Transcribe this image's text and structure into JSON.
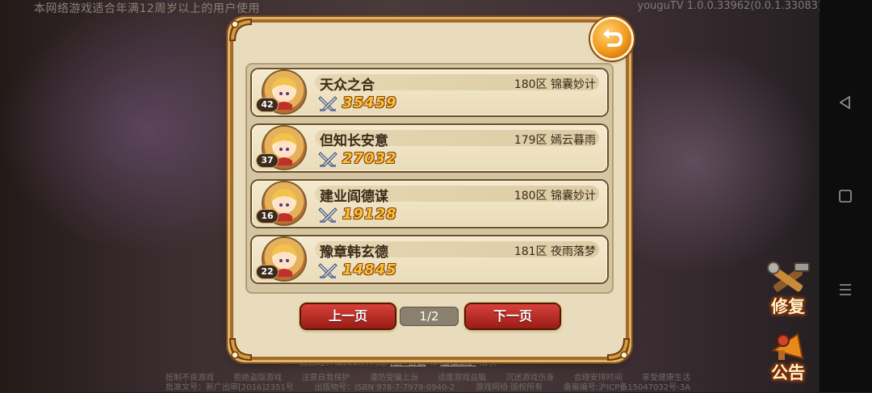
{
  "top_notice": "本网络游戏适合年满12周岁以上的用户使用",
  "version": "youguTV 1.0.0.33962(0.0.1.33083)",
  "leaderboard": {
    "rows": [
      {
        "level": "42",
        "name": "天众之合",
        "server": "180区 锦囊妙计",
        "power": "35459"
      },
      {
        "level": "37",
        "name": "但知长安意",
        "server": "179区 嫣云暮雨",
        "power": "27032"
      },
      {
        "level": "16",
        "name": "建业阎德谋",
        "server": "180区 锦囊妙计",
        "power": "19128"
      },
      {
        "level": "22",
        "name": "豫章韩玄德",
        "server": "181区 夜雨落梦",
        "power": "14845"
      }
    ],
    "prev_label": "上一页",
    "next_label": "下一页",
    "page_indicator": "1/2"
  },
  "footer": {
    "agree_prefix": "我已经详细阅读并同意",
    "user_agreement": "用户协议",
    "and": "和",
    "privacy": "隐私保护",
    "guide": "指引",
    "row1": [
      "抵制不良游戏",
      "拒绝盗版游戏",
      "注意自我保护",
      "谨防受骗上当",
      "适度游戏益脑",
      "沉迷游戏伤身",
      "合理安排时间",
      "享受健康生活"
    ],
    "row2": [
      "批准文号：新广出审[2016]2351号",
      "出版物号：ISBN 978-7-7979-0940-2",
      "游戏网络·版权所有",
      "备案编号:沪ICP备15047032号-3A"
    ]
  },
  "side_buttons": {
    "repair": "修复",
    "notice": "公告"
  },
  "icons": {
    "close": "return-arrow-icon",
    "power": "crossed-swords-icon",
    "nav_back": "triangle-back-icon",
    "nav_home": "square-home-icon",
    "nav_menu": "menu-lines-icon"
  },
  "colors": {
    "accent_button": "#c0302a",
    "power_text": "#f7c538",
    "frame_gold": "#e0b468"
  }
}
